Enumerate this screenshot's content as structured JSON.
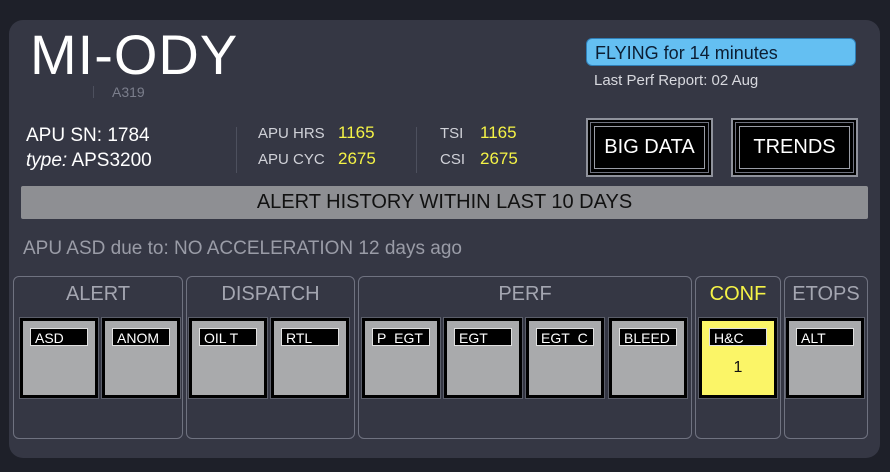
{
  "header": {
    "registration": "MI-ODY",
    "aircraft_type": "A319",
    "flight_status": "FLYING for 14 minutes",
    "last_perf_report": "Last Perf Report: 02 Aug"
  },
  "apu": {
    "sn_label": "APU SN:",
    "sn_value": "1784",
    "type_label": "type:",
    "type_value": "APS3200"
  },
  "stats": {
    "apu_hrs_label": "APU HRS",
    "apu_hrs": "1165",
    "apu_cyc_label": "APU CYC",
    "apu_cyc": "2675",
    "tsi_label": "TSI",
    "tsi": "1165",
    "csi_label": "CSI",
    "csi": "2675"
  },
  "buttons": {
    "big_data": "BIG DATA",
    "trends": "TRENDS"
  },
  "alert_banner": "ALERT HISTORY WITHIN LAST 10 DAYS",
  "alert_message": "APU ASD due to: NO ACCELERATION 12 days ago",
  "groups": {
    "alert": {
      "title": "ALERT",
      "tiles": [
        {
          "label": "ASD"
        },
        {
          "label": "ANOM"
        }
      ]
    },
    "dispatch": {
      "title": "DISPATCH",
      "tiles": [
        {
          "label": "OIL T"
        },
        {
          "label": "RTL"
        }
      ]
    },
    "perf": {
      "title": "PERF",
      "tiles": [
        {
          "label": "P_EGT"
        },
        {
          "label": "EGT"
        },
        {
          "label": "EGT_C"
        },
        {
          "label": "BLEED"
        }
      ]
    },
    "conf": {
      "title": "CONF",
      "tiles": [
        {
          "label": "H&C",
          "count": "1"
        }
      ]
    },
    "etops": {
      "title": "ETOPS",
      "tiles": [
        {
          "label": "ALT"
        }
      ]
    }
  },
  "colors": {
    "status_bg": "#64bff2",
    "value_yellow": "#f5f346",
    "active_tile": "#fbf567",
    "tile_gray": "#a9aaac"
  }
}
